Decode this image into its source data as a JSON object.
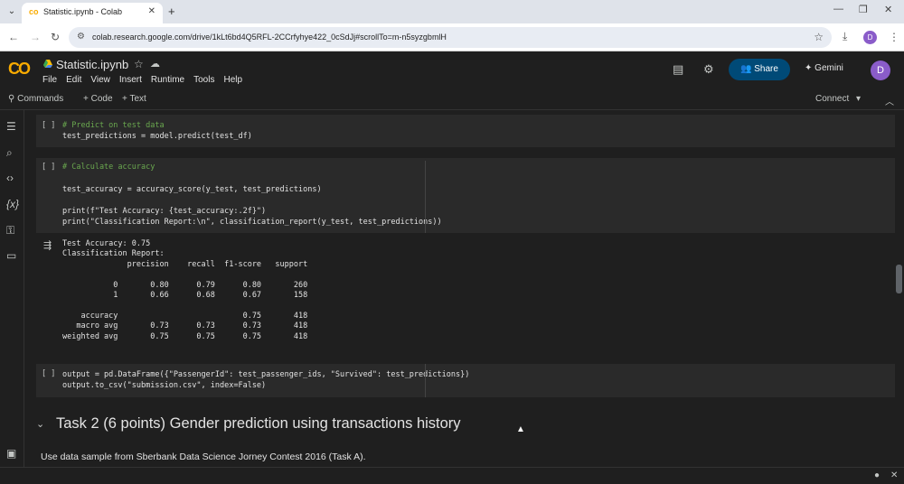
{
  "browser": {
    "tab_title": "Statistic.ipynb - Colab",
    "tab_icon": "co",
    "new_tab": "+",
    "url": "colab.research.google.com/drive/1kLt6bd4Q5RFL-2CCrfyhye422_0cSdJj#scrollTo=m-n5syzgbmlH",
    "profile_initial": "D"
  },
  "header": {
    "logo": "CO",
    "title": "Statistic.ipynb",
    "menu": [
      "File",
      "Edit",
      "View",
      "Insert",
      "Runtime",
      "Tools",
      "Help"
    ],
    "share_label": "Share",
    "gemini_label": "Gemini",
    "user_initial": "D",
    "share_color": "#004a77",
    "logo_color": "#f9ab00"
  },
  "toolbar": {
    "commands": "Commands",
    "add_code": "+ Code",
    "add_text": "+ Text",
    "connect": "Connect"
  },
  "cells": [
    {
      "bracket": "[ ]",
      "lines": [
        "# Predict on test data",
        "test_predictions = model.predict(test_df)"
      ]
    },
    {
      "bracket": "[ ]",
      "lines": [
        "# Calculate accuracy",
        "",
        "test_accuracy = accuracy_score(y_test, test_predictions)",
        "",
        "print(f\"Test Accuracy: {test_accuracy:.2f}\")",
        "print(\"Classification Report:\\n\", classification_report(y_test, test_predictions))"
      ]
    },
    {
      "bracket": "[ ]",
      "lines": [
        "output = pd.DataFrame({\"PassengerId\": test_passenger_ids, \"Survived\": test_predictions})",
        "output.to_csv(\"submission.csv\", index=False)"
      ]
    }
  ],
  "output_text": "Test Accuracy: 0.75\nClassification Report:\n              precision    recall  f1-score   support\n\n           0       0.80      0.79      0.80       260\n           1       0.66      0.68      0.67       158\n\n    accuracy                           0.75       418\n   macro avg       0.73      0.73      0.73       418\nweighted avg       0.75      0.75      0.75       418",
  "section": {
    "title": "Task 2 (6 points) Gender prediction using transactions history",
    "text": "Use data sample from Sberbank Data Science Jorney Contest 2016 (Task A)."
  }
}
